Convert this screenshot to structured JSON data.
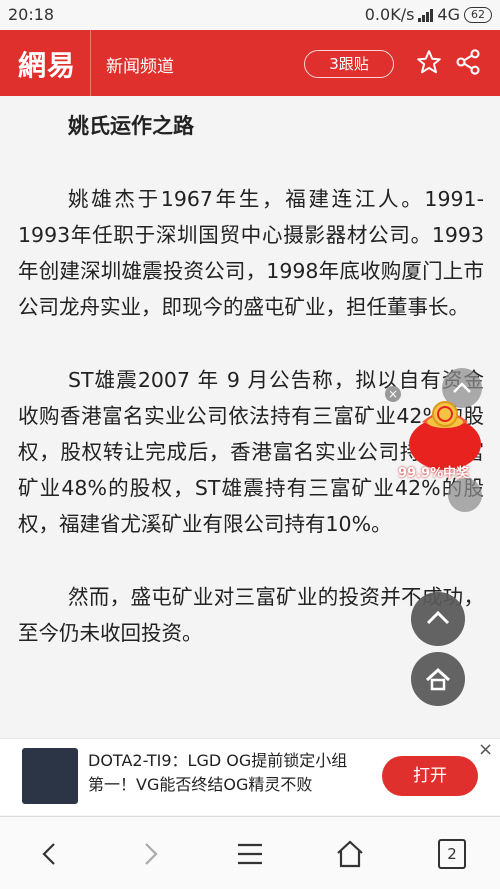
{
  "status": {
    "time": "20:18",
    "speed": "0.0K/s",
    "network": "4G",
    "battery": "62"
  },
  "header": {
    "logo": "網易",
    "channel": "新闻频道",
    "comments": "3跟贴"
  },
  "article": {
    "heading": "姚氏运作之路",
    "paragraphs": [
      "姚雄杰于1967年生，福建连江人。1991-1993年任职于深圳国贸中心摄影器材公司。1993年创建深圳雄震投资公司，1998年底收购厦门上市公司龙舟实业，即现今的盛屯矿业，担任董事长。",
      "ST雄震2007 年 9 月公告称，拟以自有资金收购香港富名实业公司依法持有三富矿业42%的股权，股权转让完成后，香港富名实业公司持有三富矿业48%的股权，ST雄震持有三富矿业42%的股权，福建省尤溪矿业有限公司持有10%。",
      "然而，盛屯矿业对三富矿业的投资并不成功，至今仍未收回投资。"
    ]
  },
  "floating": {
    "prize": "99.9%中奖",
    "close": "×"
  },
  "ad": {
    "text": "DOTA2-TI9：LGD OG提前锁定小组第一！VG能否终结OG精灵不败",
    "button": "打开",
    "close": "×"
  },
  "nav": {
    "tabs": "2"
  },
  "colors": {
    "brand": "#e0302d"
  }
}
